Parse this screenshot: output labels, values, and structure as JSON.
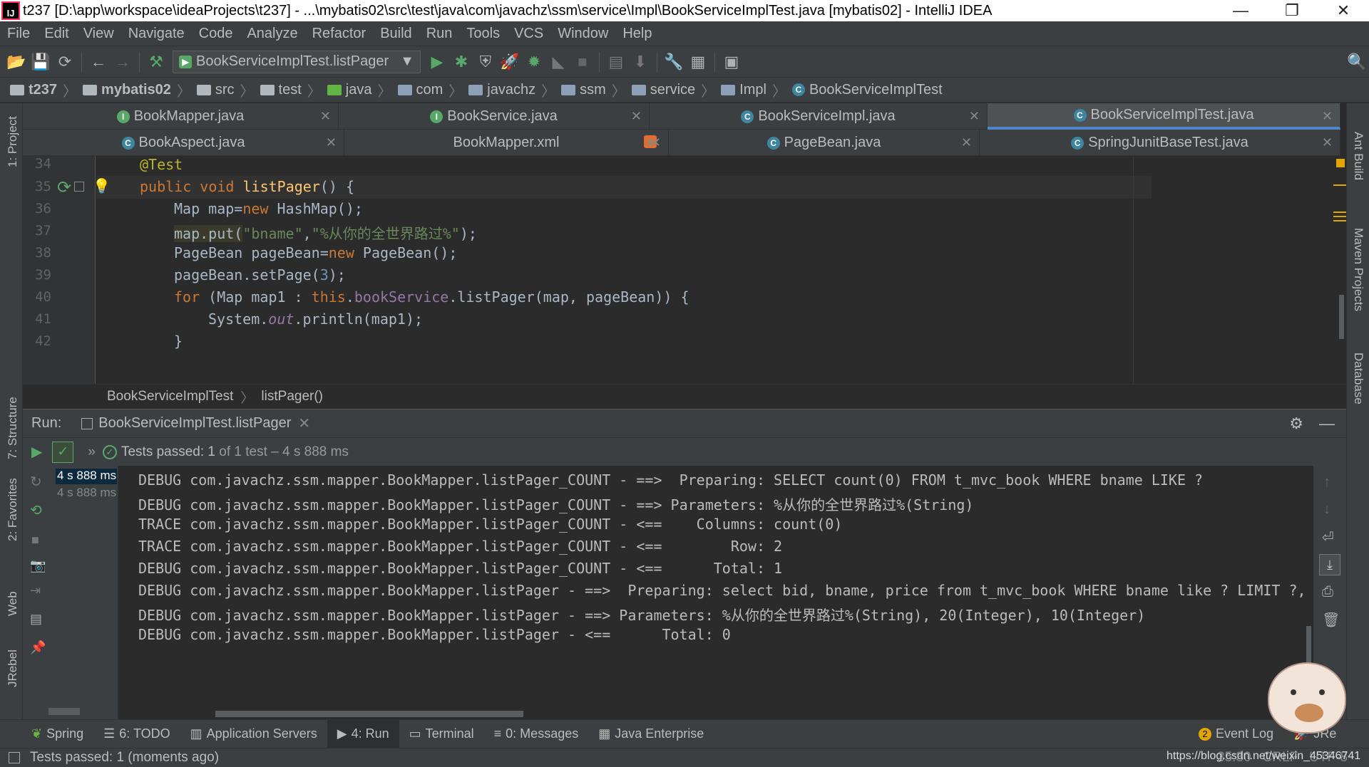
{
  "window": {
    "title": "t237 [D:\\app\\workspace\\ideaProjects\\t237] - ...\\mybatis02\\src\\test\\java\\com\\javachz\\ssm\\service\\Impl\\BookServiceImplTest.java [mybatis02] - IntelliJ IDEA",
    "minimize": "—",
    "restore": "❐",
    "close": "✕"
  },
  "menu": [
    "File",
    "Edit",
    "View",
    "Navigate",
    "Code",
    "Analyze",
    "Refactor",
    "Build",
    "Run",
    "Tools",
    "VCS",
    "Window",
    "Help"
  ],
  "toolbar": {
    "run_config": "BookServiceImplTest.listPager"
  },
  "navbar": {
    "crumbs": [
      "t237",
      "mybatis02",
      "src",
      "test",
      "java",
      "com",
      "javachz",
      "ssm",
      "service",
      "Impl",
      "BookServiceImplTest"
    ]
  },
  "tabs": {
    "row1": [
      "BookMapper.java",
      "BookService.java",
      "BookServiceImpl.java",
      "BookServiceImplTest.java"
    ],
    "row2": [
      "BookAspect.java",
      "BookMapper.xml",
      "PageBean.java",
      "SpringJunitBaseTest.java"
    ]
  },
  "side_left": [
    "1: Project",
    "7: Structure",
    "2: Favorites",
    "Web",
    "JRebel"
  ],
  "side_right": [
    "Ant Build",
    "Maven Projects",
    "Database"
  ],
  "editor": {
    "line_numbers": [
      "34",
      "35",
      "36",
      "37",
      "38",
      "39",
      "40",
      "41",
      "42"
    ],
    "lines": {
      "l34": "@Test",
      "l35_kw": "public void ",
      "l35_fn": "listPager",
      "l35_rest": "() {",
      "l36_a": "Map map=",
      "l36_kw": "new ",
      "l36_b": "HashMap();",
      "l37_a": "map.put(",
      "l37_s1": "\"bname\"",
      "l37_c": ",",
      "l37_s2": "\"%从你的全世界路过%\"",
      "l37_e": ");",
      "l38_a": "PageBean pageBean=",
      "l38_kw": "new ",
      "l38_b": "PageBean();",
      "l39_a": "pageBean.setPage(",
      "l39_n": "3",
      "l39_b": ");",
      "l40_kw": "for ",
      "l40_a": "(Map map1 : ",
      "l40_this": "this",
      "l40_dot": ".",
      "l40_fld": "bookService",
      "l40_b": ".listPager(map, pageBean)) {",
      "l41_a": "System.",
      "l41_out": "out",
      "l41_b": ".println(map1);",
      "l42": "}"
    }
  },
  "editor_breadcrumb": {
    "class": "BookServiceImplTest",
    "method": "listPager()"
  },
  "run": {
    "label": "Run:",
    "tab": "BookServiceImplTest.listPager",
    "status_bold": "Tests passed: ",
    "status_count": "1",
    "status_rest": " of 1 test – 4 s 888 ms",
    "tree": [
      "4 s 888 ms",
      "4 s 888 ms"
    ]
  },
  "console": [
    "DEBUG com.javachz.ssm.mapper.BookMapper.listPager_COUNT - ==>  Preparing: SELECT count(0) FROM t_mvc_book WHERE bname LIKE ?",
    "DEBUG com.javachz.ssm.mapper.BookMapper.listPager_COUNT - ==> Parameters: %从你的全世界路过%(String)",
    "TRACE com.javachz.ssm.mapper.BookMapper.listPager_COUNT - <==    Columns: count(0)",
    "TRACE com.javachz.ssm.mapper.BookMapper.listPager_COUNT - <==        Row: 2",
    "DEBUG com.javachz.ssm.mapper.BookMapper.listPager_COUNT - <==      Total: 1",
    "DEBUG com.javachz.ssm.mapper.BookMapper.listPager - ==>  Preparing: select bid, bname, price from t_mvc_book WHERE bname like ? LIMIT ?, ?",
    "DEBUG com.javachz.ssm.mapper.BookMapper.listPager - ==> Parameters: %从你的全世界路过%(String), 20(Integer), 10(Integer)",
    "DEBUG com.javachz.ssm.mapper.BookMapper.listPager - <==      Total: 0"
  ],
  "bottom_tools": [
    "Spring",
    "6: TODO",
    "Application Servers",
    "4: Run",
    "Terminal",
    "0: Messages",
    "Java Enterprise"
  ],
  "bottom_right": [
    "Event Log",
    "JRe"
  ],
  "event_count": "2",
  "statusbar": {
    "message": "Tests passed: 1 (moments ago)",
    "pos": "35:30",
    "crlf": "CRLF",
    "enc": "UTF-8",
    "watermark": "https://blog.csdn.net/weixin_45346741"
  }
}
